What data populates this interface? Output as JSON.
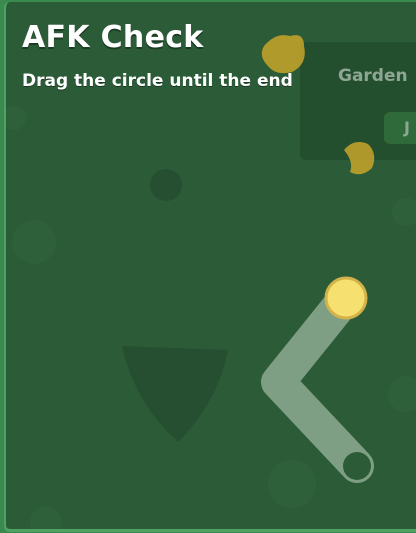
{
  "dialog": {
    "title": "AFK Check",
    "instruction": "Drag the circle until the end"
  },
  "background_ui": {
    "garden_label": "Garden",
    "button_partial": "J"
  },
  "colors": {
    "panel": "#2b5c37",
    "border": "#4ea363",
    "track": "#7f9f84",
    "handle": "#f5e070",
    "handle_outline": "#d4b24a",
    "blob": "#c8a42a"
  },
  "drag_progress": 0
}
